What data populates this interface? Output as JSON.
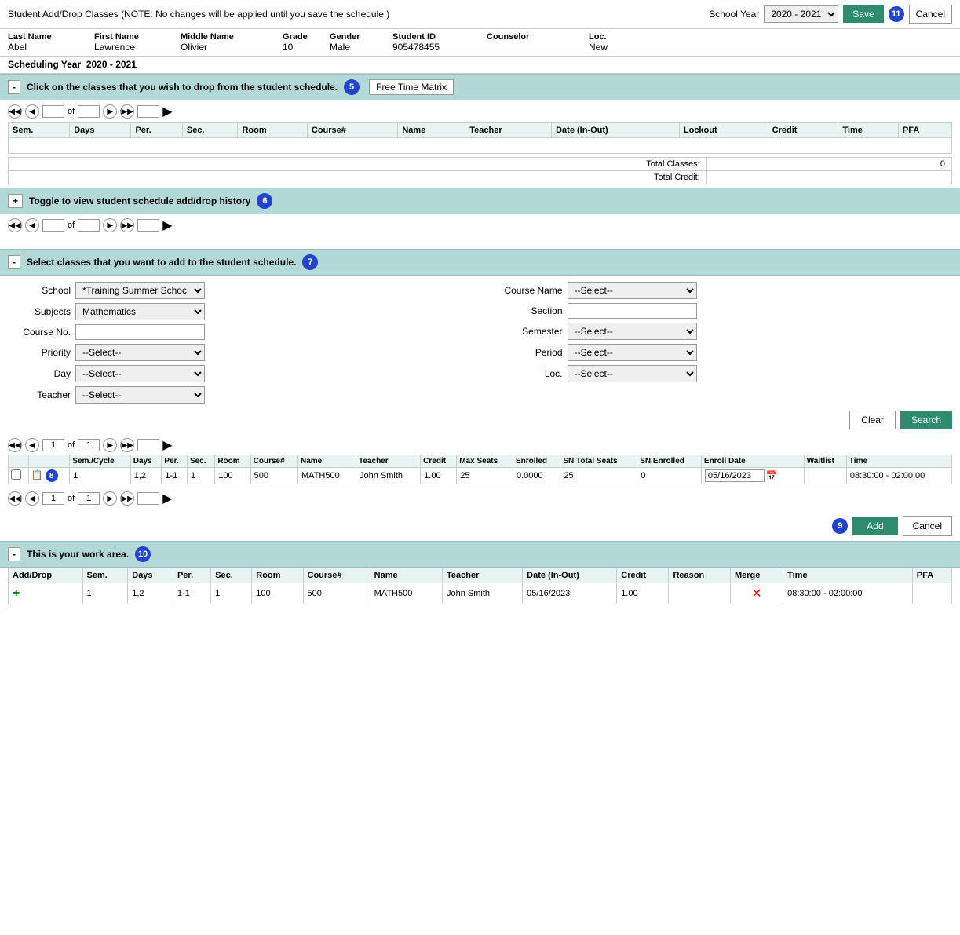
{
  "header": {
    "title": "Student Add/Drop Classes (NOTE: No changes will be applied until you save the schedule.)",
    "school_year_label": "School Year",
    "school_year_value": "2020 - 2021",
    "save_label": "Save",
    "cancel_label": "Cancel",
    "save_badge": "11"
  },
  "student": {
    "last_name_label": "Last Name",
    "last_name": "Abel",
    "first_name_label": "First Name",
    "first_name": "Lawrence",
    "middle_name_label": "Middle Name",
    "middle_name": "Olivier",
    "grade_label": "Grade",
    "grade": "10",
    "gender_label": "Gender",
    "gender": "Male",
    "student_id_label": "Student ID",
    "student_id": "905478455",
    "counselor_label": "Counselor",
    "counselor": "",
    "loc_label": "Loc.",
    "loc": "New",
    "scheduling_year_label": "Scheduling Year",
    "scheduling_year": "2020 - 2021"
  },
  "drop_section": {
    "toggle_label": "-",
    "text": "Click on the classes that you wish to drop from the student schedule.",
    "badge": "5",
    "free_time_btn": "Free Time Matrix",
    "columns": [
      "Sem.",
      "Days",
      "Per.",
      "Sec.",
      "Room",
      "Course#",
      "Name",
      "Teacher",
      "Date (In-Out)",
      "Lockout",
      "Credit",
      "Time",
      "PFA"
    ],
    "total_classes_label": "Total Classes:",
    "total_classes": "0",
    "total_credit_label": "Total Credit:",
    "total_credit": ""
  },
  "history_section": {
    "toggle_label": "+",
    "text": "Toggle to view student schedule add/drop history",
    "badge": "6"
  },
  "add_section": {
    "toggle_label": "-",
    "text": "Select classes that you want to add to the student schedule.",
    "badge": "7",
    "school_label": "School",
    "school_value": "*Training Summer Schoc",
    "subjects_label": "Subjects",
    "subjects_value": "Mathematics",
    "course_no_label": "Course No.",
    "course_no_value": "",
    "course_name_label": "Course Name",
    "course_name_value": "--Select--",
    "section_label": "Section",
    "section_value": "",
    "priority_label": "Priority",
    "priority_value": "--Select--",
    "semester_label": "Semester",
    "semester_value": "--Select--",
    "day_label": "Day",
    "day_value": "--Select--",
    "period_label": "Period",
    "period_value": "--Select--",
    "teacher_label": "Teacher",
    "teacher_value": "--Select--",
    "loc_label": "Loc.",
    "loc_value": "--Select--",
    "clear_btn": "Clear",
    "search_btn": "Search"
  },
  "results": {
    "columns": [
      "",
      "",
      "Sem./Cycle",
      "Days",
      "Per.",
      "Sec.",
      "Room",
      "Course#",
      "Name",
      "Teacher",
      "Credit",
      "Max Seats",
      "Enrolled",
      "SN Total Seats",
      "SN Enrolled",
      "Enroll Date",
      "Waitlist",
      "Time"
    ],
    "badge": "8",
    "row": {
      "sem": "1",
      "days": "1,2",
      "per": "1-1",
      "sec": "1",
      "room": "100",
      "course_no": "500",
      "name": "MATH500",
      "teacher": "John Smith",
      "credit": "1.00",
      "max_seats": "25",
      "enrolled": "0.0000",
      "sn_total": "25",
      "sn_enrolled": "0",
      "enroll_date": "05/16/2023",
      "waitlist": "",
      "time": "08:30:00 - 02:00:00"
    },
    "pagination_page": "1",
    "pagination_of": "1"
  },
  "action_buttons": {
    "add_label": "Add",
    "cancel_label": "Cancel",
    "add_badge": "9"
  },
  "work_area": {
    "toggle_label": "-",
    "text": "This is your work area.",
    "badge": "10",
    "columns": [
      "Add/Drop",
      "Sem.",
      "Days",
      "Per.",
      "Sec.",
      "Room",
      "Course#",
      "Name",
      "Teacher",
      "Date (In-Out)",
      "Credit",
      "Reason",
      "Merge",
      "Time",
      "PFA"
    ],
    "row": {
      "add_drop": "+",
      "sem": "1",
      "days": "1,2",
      "per": "1-1",
      "sec": "1",
      "room": "100",
      "course_no": "500",
      "name": "MATH500",
      "teacher": "John Smith",
      "date": "05/16/2023",
      "credit": "1.00",
      "reason": "",
      "merge": "✕",
      "time": "08:30:00 - 02:00:00",
      "pfa": ""
    }
  },
  "pagination": {
    "page": "1",
    "of": "1",
    "page2": "1",
    "of2": "1"
  }
}
